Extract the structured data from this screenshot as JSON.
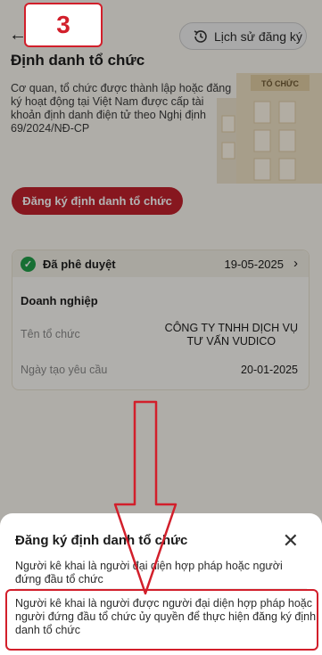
{
  "step_badge": "3",
  "header": {
    "history_label": "Lịch sử đăng ký",
    "title": "Định danh tổ chức",
    "description": "Cơ quan, tổ chức được thành lập hoặc đăng ký hoạt động tại Việt Nam được cấp tài khoản định danh điện tử theo Nghị định 69/2024/NĐ-CP",
    "building_sign": "TỔ CHỨC"
  },
  "register_button": "Đăng ký định danh tổ chức",
  "card": {
    "status": "Đã phê duyệt",
    "date": "19-05-2025",
    "org_type": "Doanh nghiệp",
    "org_name_label": "Tên tổ chức",
    "org_name_line1": "CÔNG TY TNHH DỊCH VỤ",
    "org_name_line2": "TƯ VẤN VUDICO",
    "created_label": "Ngày tạo yêu cầu",
    "created_value": "20-01-2025"
  },
  "sheet": {
    "title": "Đăng ký định danh tổ chức",
    "option1": "Người kê khai là người đại diện hợp pháp hoặc người đứng đầu tổ chức",
    "option2": "Người kê khai là người được người đại diện hợp pháp hoặc người đứng đầu tổ chức ủy quyền để thực hiện đăng ký định danh tổ chức"
  },
  "colors": {
    "accent_red": "#c2222d",
    "annotation_red": "#d21f2b",
    "approved_green": "#21a04a"
  }
}
